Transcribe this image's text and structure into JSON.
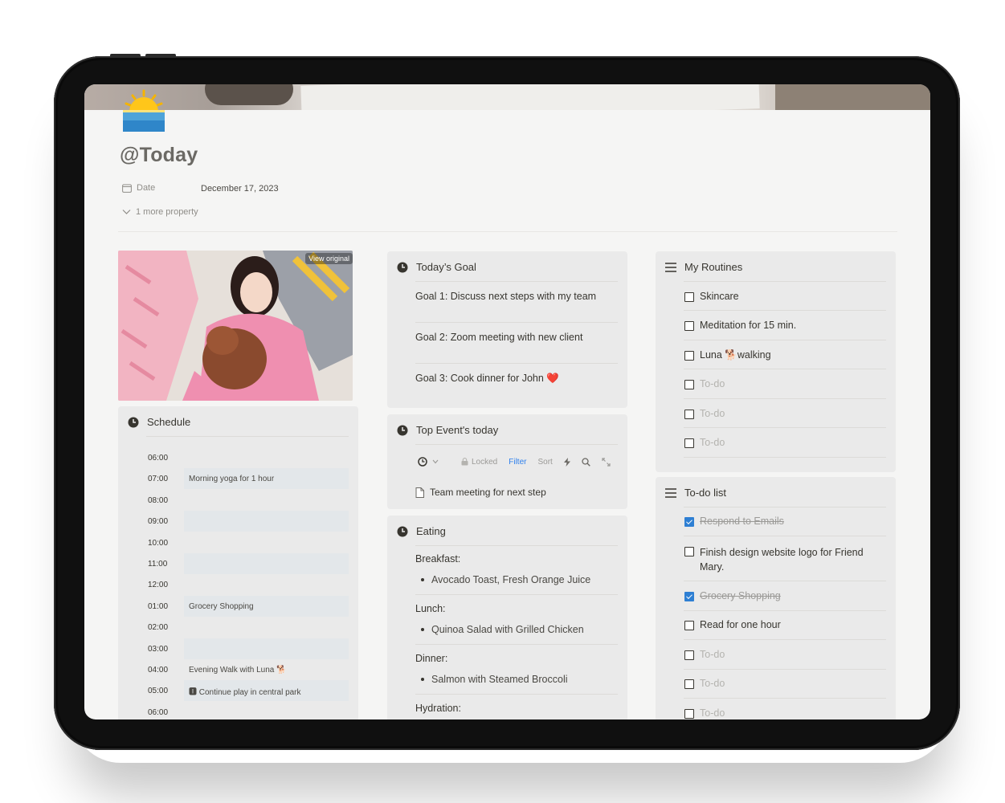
{
  "page": {
    "title": "@Today",
    "properties": [
      {
        "name": "Date",
        "value": "December 17, 2023"
      }
    ],
    "more_properties": "1 more property"
  },
  "photo": {
    "view_original": "View original"
  },
  "schedule": {
    "title": "Schedule",
    "rows": [
      {
        "time": "06:00",
        "event": ""
      },
      {
        "time": "07:00",
        "event": "Morning yoga for 1 hour"
      },
      {
        "time": "08:00",
        "event": ""
      },
      {
        "time": "09:00",
        "event": ""
      },
      {
        "time": "10:00",
        "event": ""
      },
      {
        "time": "11:00",
        "event": ""
      },
      {
        "time": "12:00",
        "event": ""
      },
      {
        "time": "01:00",
        "event": "Grocery Shopping"
      },
      {
        "time": "02:00",
        "event": ""
      },
      {
        "time": "03:00",
        "event": ""
      },
      {
        "time": "04:00",
        "event": "Evening Walk with Luna 🐕"
      },
      {
        "time": "05:00",
        "event": "🅸 Continue  play in central park"
      },
      {
        "time": "06:00",
        "event": ""
      }
    ]
  },
  "goals": {
    "title": "Today’s Goal",
    "items": [
      "Goal 1: Discuss next steps with my team",
      "Goal 2: Zoom meeting with new client",
      "Goal 3: Cook dinner for John ❤️"
    ]
  },
  "events": {
    "title": "Top Event's today",
    "toolbar": {
      "locked": "Locked",
      "filter": "Filter",
      "sort": "Sort"
    },
    "items": [
      "Team meeting for next step"
    ]
  },
  "eating": {
    "title": "Eating",
    "sections": [
      {
        "label": "Breakfast:",
        "item": "Avocado Toast, Fresh Orange Juice"
      },
      {
        "label": "Lunch:",
        "item": "Quinoa Salad with Grilled Chicken"
      },
      {
        "label": "Dinner:",
        "item": "Salmon with Steamed Broccoli"
      },
      {
        "label": "Hydration:",
        "item": ""
      }
    ]
  },
  "routines": {
    "title": "My Routines",
    "items": [
      {
        "label": "Skincare",
        "checked": false
      },
      {
        "label": "Meditation for 15 min.",
        "checked": false
      },
      {
        "label": "Luna 🐕walking",
        "checked": false
      },
      {
        "label": "To-do",
        "checked": false
      },
      {
        "label": "To-do",
        "checked": false
      },
      {
        "label": "To-do",
        "checked": false
      }
    ]
  },
  "todo": {
    "title": "To-do list",
    "items": [
      {
        "label": "Respond to Emails",
        "checked": true
      },
      {
        "label": "Finish design website logo for Friend Mary.",
        "checked": false
      },
      {
        "label": "Grocery Shopping",
        "checked": true
      },
      {
        "label": "Read for one hour",
        "checked": false
      },
      {
        "label": "To-do",
        "checked": false
      },
      {
        "label": "To-do",
        "checked": false
      },
      {
        "label": "To-do",
        "checked": false
      }
    ]
  },
  "colors": {
    "accent": "#2e7fd3",
    "card": "#eaeaea",
    "text": "#37352f"
  }
}
